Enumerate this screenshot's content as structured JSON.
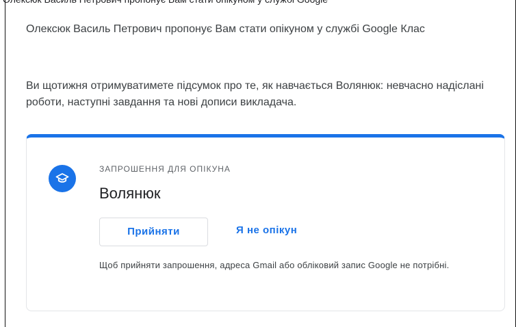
{
  "email": {
    "header_line": "Олексюк Василь Петрович пропонує Вам стати опікуном у службі Google",
    "intro": "Олексюк Василь Петрович пропонує Вам стати опікуном у службі Google Клас",
    "summary": "Ви щотижня отримуватимете підсумок про те, як навчається Волянюк: невчасно надіслані роботи, наступні завдання та нові дописи викладача."
  },
  "card": {
    "icon": "graduation-cap-icon",
    "eyebrow": "ЗАПРОШЕННЯ ДЛЯ ОПІКУНА",
    "student_name": "Волянюк",
    "accept_label": "Прийняти",
    "decline_label": "Я не опікун",
    "note": "Щоб прийняти запрошення, адреса Gmail або обліковий запис Google не потрібні."
  },
  "colors": {
    "accent": "#1a73e8",
    "text": "#3c4043",
    "muted": "#5f6368",
    "border": "#e3e5e8"
  }
}
